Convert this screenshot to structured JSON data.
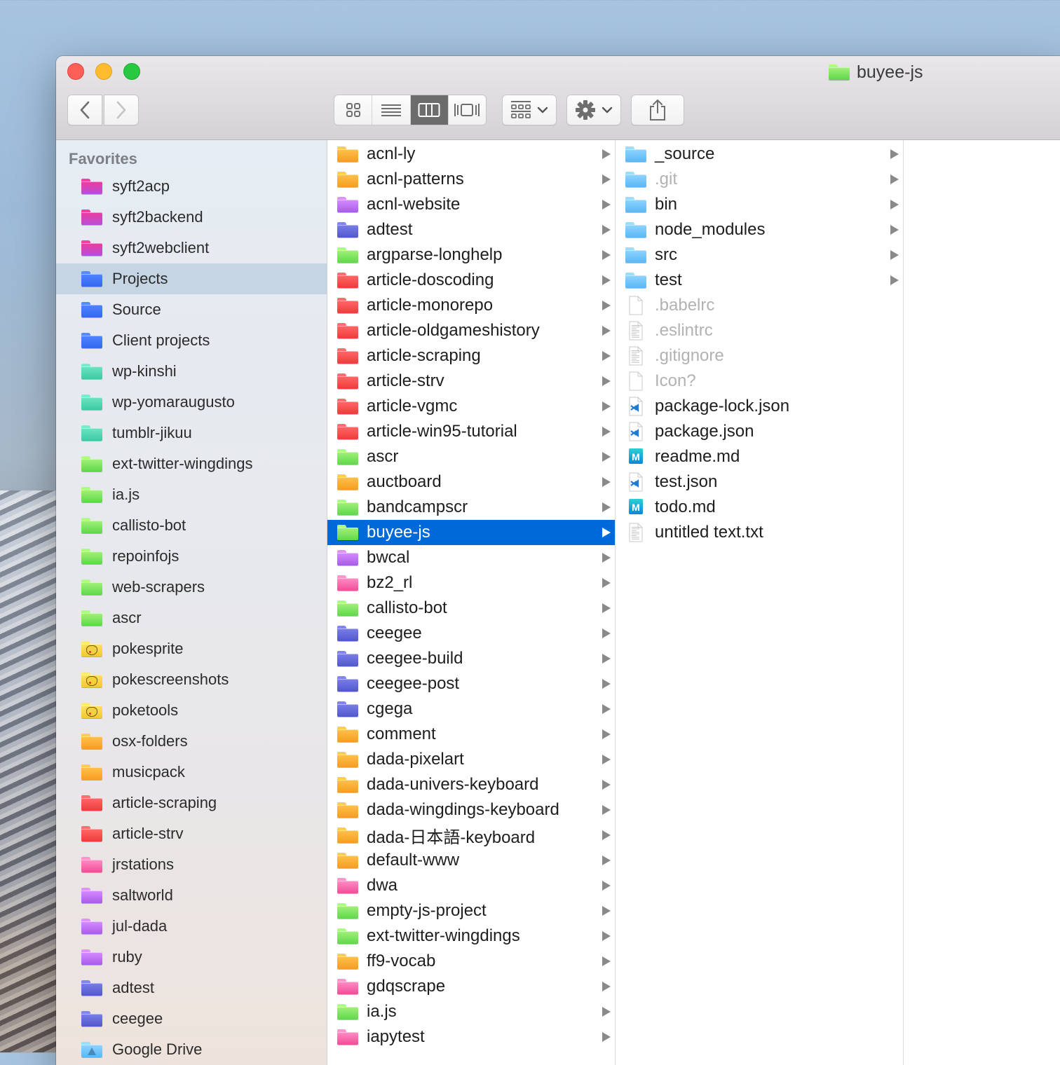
{
  "window": {
    "title": "buyee-js",
    "title_folder_color": "#6ad84a"
  },
  "toolbar": {
    "back": "back",
    "forward": "forward",
    "view_modes": [
      "icon",
      "list",
      "column",
      "gallery"
    ],
    "active_view": "column",
    "arrange": "arrange",
    "action": "action",
    "share": "share"
  },
  "colors": {
    "pinkpurple": [
      "#ec3b9e",
      "#b64fd6"
    ],
    "blue": [
      "#4f84ff",
      "#3468f0"
    ],
    "teal": [
      "#6fe3c1",
      "#3ccba3"
    ],
    "green": [
      "#a3f17a",
      "#5fd84a"
    ],
    "yellow": [
      "#ffe066",
      "#f4c82c"
    ],
    "orange": [
      "#ffc14d",
      "#f79d21"
    ],
    "red": [
      "#ff6868",
      "#f03a3a"
    ],
    "pink": [
      "#ff8dc5",
      "#f04d97"
    ],
    "purple": [
      "#d58cff",
      "#a95ce8"
    ],
    "indigo": [
      "#7a7ee8",
      "#5158cc"
    ],
    "lightblue": [
      "#8fd4ff",
      "#5ab8f5"
    ],
    "selection": "#0069d9",
    "sidebar_selection": "#c6d5e4"
  },
  "sidebar": {
    "heading": "Favorites",
    "items": [
      {
        "label": "syft2acp",
        "color": "pinkpurple"
      },
      {
        "label": "syft2backend",
        "color": "pinkpurple"
      },
      {
        "label": "syft2webclient",
        "color": "pinkpurple"
      },
      {
        "label": "Projects",
        "color": "blue",
        "selected": true
      },
      {
        "label": "Source",
        "color": "blue"
      },
      {
        "label": "Client projects",
        "color": "blue"
      },
      {
        "label": "wp-kinshi",
        "color": "teal"
      },
      {
        "label": "wp-yomaraugusto",
        "color": "teal"
      },
      {
        "label": "tumblr-jikuu",
        "color": "teal"
      },
      {
        "label": "ext-twitter-wingdings",
        "color": "green"
      },
      {
        "label": "ia.js",
        "color": "green"
      },
      {
        "label": "callisto-bot",
        "color": "green"
      },
      {
        "label": "repoinfojs",
        "color": "green"
      },
      {
        "label": "web-scrapers",
        "color": "green"
      },
      {
        "label": "ascr",
        "color": "green"
      },
      {
        "label": "pokesprite",
        "color": "yellow",
        "icon": "pikachu-folder"
      },
      {
        "label": "pokescreenshots",
        "color": "yellow",
        "icon": "pikachu-folder"
      },
      {
        "label": "poketools",
        "color": "yellow",
        "icon": "pikachu-folder"
      },
      {
        "label": "osx-folders",
        "color": "orange"
      },
      {
        "label": "musicpack",
        "color": "orange"
      },
      {
        "label": "article-scraping",
        "color": "red"
      },
      {
        "label": "article-strv",
        "color": "red"
      },
      {
        "label": "jrstations",
        "color": "pink"
      },
      {
        "label": "saltworld",
        "color": "purple"
      },
      {
        "label": "jul-dada",
        "color": "purple"
      },
      {
        "label": "ruby",
        "color": "purple"
      },
      {
        "label": "adtest",
        "color": "indigo"
      },
      {
        "label": "ceegee",
        "color": "indigo"
      },
      {
        "label": "Google Drive",
        "color": "lightblue",
        "icon": "google-drive-folder"
      }
    ]
  },
  "column1": {
    "items": [
      {
        "label": "acnl-ly",
        "color": "orange"
      },
      {
        "label": "acnl-patterns",
        "color": "orange"
      },
      {
        "label": "acnl-website",
        "color": "purple"
      },
      {
        "label": "adtest",
        "color": "indigo"
      },
      {
        "label": "argparse-longhelp",
        "color": "green"
      },
      {
        "label": "article-doscoding",
        "color": "red"
      },
      {
        "label": "article-monorepo",
        "color": "red"
      },
      {
        "label": "article-oldgameshistory",
        "color": "red"
      },
      {
        "label": "article-scraping",
        "color": "red"
      },
      {
        "label": "article-strv",
        "color": "red"
      },
      {
        "label": "article-vgmc",
        "color": "red"
      },
      {
        "label": "article-win95-tutorial",
        "color": "red"
      },
      {
        "label": "ascr",
        "color": "green"
      },
      {
        "label": "auctboard",
        "color": "orange"
      },
      {
        "label": "bandcampscr",
        "color": "green"
      },
      {
        "label": "buyee-js",
        "color": "green",
        "selected": true
      },
      {
        "label": "bwcal",
        "color": "purple"
      },
      {
        "label": "bz2_rl",
        "color": "pink"
      },
      {
        "label": "callisto-bot",
        "color": "green"
      },
      {
        "label": "ceegee",
        "color": "indigo"
      },
      {
        "label": "ceegee-build",
        "color": "indigo"
      },
      {
        "label": "ceegee-post",
        "color": "indigo"
      },
      {
        "label": "cgega",
        "color": "indigo"
      },
      {
        "label": "comment",
        "color": "orange"
      },
      {
        "label": "dada-pixelart",
        "color": "orange"
      },
      {
        "label": "dada-univers-keyboard",
        "color": "orange"
      },
      {
        "label": "dada-wingdings-keyboard",
        "color": "orange"
      },
      {
        "label": "dada-日本語-keyboard",
        "color": "orange"
      },
      {
        "label": "default-www",
        "color": "orange"
      },
      {
        "label": "dwa",
        "color": "pink"
      },
      {
        "label": "empty-js-project",
        "color": "green"
      },
      {
        "label": "ext-twitter-wingdings",
        "color": "green"
      },
      {
        "label": "ff9-vocab",
        "color": "orange"
      },
      {
        "label": "gdqscrape",
        "color": "pink"
      },
      {
        "label": "ia.js",
        "color": "green"
      },
      {
        "label": "iapytest",
        "color": "pink"
      }
    ]
  },
  "column2": {
    "items": [
      {
        "label": "_source",
        "type": "folder",
        "color": "lightblue"
      },
      {
        "label": ".git",
        "type": "folder",
        "color": "lightblue",
        "hidden": true
      },
      {
        "label": "bin",
        "type": "folder",
        "color": "lightblue"
      },
      {
        "label": "node_modules",
        "type": "folder",
        "color": "lightblue"
      },
      {
        "label": "src",
        "type": "folder",
        "color": "lightblue"
      },
      {
        "label": "test",
        "type": "folder",
        "color": "lightblue"
      },
      {
        "label": ".babelrc",
        "type": "blank",
        "hidden": true
      },
      {
        "label": ".eslintrc",
        "type": "text",
        "hidden": true
      },
      {
        "label": ".gitignore",
        "type": "text",
        "hidden": true
      },
      {
        "label": "Icon?",
        "type": "blank",
        "hidden": true
      },
      {
        "label": "package-lock.json",
        "type": "vscode"
      },
      {
        "label": "package.json",
        "type": "vscode"
      },
      {
        "label": "readme.md",
        "type": "markdown"
      },
      {
        "label": "test.json",
        "type": "vscode"
      },
      {
        "label": "todo.md",
        "type": "markdown"
      },
      {
        "label": "untitled text.txt",
        "type": "text"
      }
    ]
  }
}
